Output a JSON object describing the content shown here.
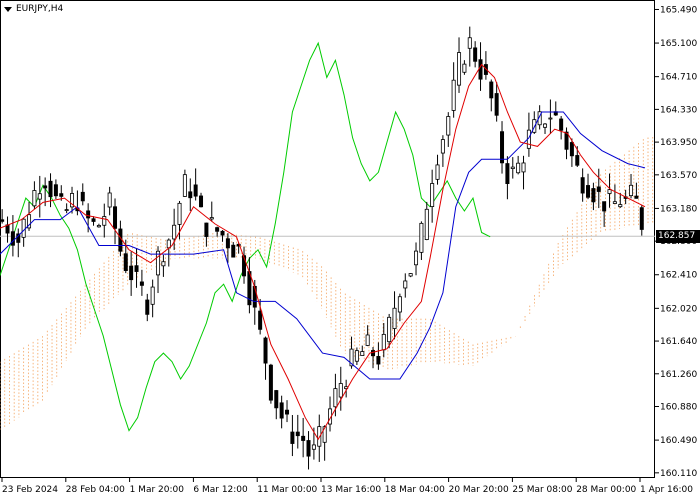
{
  "header": {
    "symbol": "EURJPY,H4",
    "menu_icon": "triangle-down-icon"
  },
  "colors": {
    "background": "#ffffff",
    "candle": "#000000",
    "tenkan": "#e00000",
    "kijun": "#0000d0",
    "chikou": "#00cc00",
    "senkou_a": "#f4a460",
    "senkou_b": "#c9a0b4",
    "current_price_line": "#c0c0c0",
    "price_tag_bg": "#000000"
  },
  "chart_data": {
    "type": "candlestick",
    "symbol": "EURJPY",
    "timeframe": "H4",
    "current_price": "162.857",
    "y_ticks": [
      "165.490",
      "165.100",
      "164.710",
      "164.330",
      "163.950",
      "163.570",
      "163.180",
      "162.800",
      "162.410",
      "162.020",
      "161.640",
      "161.260",
      "160.880",
      "160.490",
      "160.110"
    ],
    "ylim": [
      160.05,
      165.6
    ],
    "x_ticks": [
      "23 Feb 2024",
      "28 Feb 04:00",
      "1 Mar 20:00",
      "6 Mar 12:00",
      "11 Mar 00:00",
      "13 Mar 16:00",
      "18 Mar 04:00",
      "20 Mar 20:00",
      "25 Mar 08:00",
      "28 Mar 00:00",
      "1 Apr 16:00"
    ],
    "close_path": [
      [
        0,
        163.05
      ],
      [
        3,
        163.0
      ],
      [
        6,
        162.9
      ],
      [
        9,
        162.8
      ],
      [
        12,
        163.1
      ],
      [
        15,
        163.3
      ],
      [
        18,
        163.5
      ],
      [
        21,
        163.55
      ],
      [
        24,
        163.4
      ],
      [
        27,
        163.2
      ],
      [
        30,
        163.1
      ],
      [
        33,
        163.25
      ],
      [
        36,
        163.3
      ],
      [
        39,
        163.1
      ],
      [
        42,
        163.0
      ],
      [
        45,
        162.95
      ],
      [
        48,
        163.1
      ],
      [
        51,
        163.2
      ],
      [
        54,
        162.9
      ],
      [
        57,
        162.6
      ],
      [
        60,
        162.5
      ],
      [
        63,
        162.3
      ],
      [
        66,
        162.2
      ],
      [
        69,
        162.1
      ],
      [
        72,
        162.5
      ],
      [
        75,
        162.7
      ],
      [
        78,
        162.8
      ],
      [
        81,
        163.0
      ],
      [
        84,
        163.3
      ],
      [
        87,
        163.5
      ],
      [
        90,
        163.35
      ],
      [
        93,
        163.1
      ],
      [
        96,
        163.0
      ],
      [
        99,
        162.95
      ],
      [
        102,
        162.9
      ],
      [
        105,
        162.85
      ],
      [
        108,
        162.75
      ],
      [
        111,
        162.7
      ],
      [
        114,
        162.5
      ],
      [
        117,
        162.1
      ],
      [
        120,
        161.8
      ],
      [
        123,
        161.5
      ],
      [
        126,
        161.1
      ],
      [
        129,
        160.9
      ],
      [
        132,
        160.7
      ],
      [
        135,
        160.6
      ],
      [
        138,
        160.55
      ],
      [
        141,
        160.5
      ],
      [
        144,
        160.3
      ],
      [
        147,
        160.35
      ],
      [
        150,
        160.6
      ],
      [
        153,
        160.8
      ],
      [
        156,
        161.0
      ],
      [
        159,
        161.2
      ],
      [
        162,
        161.3
      ],
      [
        165,
        161.45
      ],
      [
        168,
        161.5
      ],
      [
        171,
        161.55
      ],
      [
        174,
        161.5
      ],
      [
        177,
        161.45
      ],
      [
        180,
        161.7
      ],
      [
        183,
        162.0
      ],
      [
        186,
        162.3
      ],
      [
        189,
        162.45
      ],
      [
        192,
        162.5
      ],
      [
        195,
        162.7
      ],
      [
        198,
        163.2
      ],
      [
        201,
        163.6
      ],
      [
        204,
        163.9
      ],
      [
        207,
        164.1
      ],
      [
        210,
        164.4
      ],
      [
        213,
        164.8
      ],
      [
        216,
        165.0
      ],
      [
        219,
        165.1
      ],
      [
        222,
        164.9
      ],
      [
        225,
        164.7
      ],
      [
        228,
        164.5
      ],
      [
        231,
        164.1
      ],
      [
        234,
        163.7
      ],
      [
        237,
        163.55
      ],
      [
        240,
        163.6
      ],
      [
        243,
        163.8
      ],
      [
        246,
        164.0
      ],
      [
        249,
        164.1
      ],
      [
        252,
        164.2
      ],
      [
        255,
        164.3
      ],
      [
        258,
        164.25
      ],
      [
        261,
        164.1
      ],
      [
        264,
        163.9
      ],
      [
        267,
        163.7
      ],
      [
        270,
        163.55
      ],
      [
        273,
        163.5
      ],
      [
        276,
        163.4
      ],
      [
        279,
        163.3
      ],
      [
        282,
        163.25
      ],
      [
        285,
        163.2
      ],
      [
        288,
        163.3
      ],
      [
        291,
        163.25
      ],
      [
        294,
        163.3
      ],
      [
        297,
        163.2
      ],
      [
        300,
        162.85
      ]
    ],
    "tenkan": [
      [
        0,
        162.95
      ],
      [
        10,
        163.05
      ],
      [
        20,
        163.25
      ],
      [
        30,
        163.3
      ],
      [
        40,
        163.1
      ],
      [
        50,
        163.05
      ],
      [
        60,
        162.7
      ],
      [
        70,
        162.55
      ],
      [
        80,
        162.75
      ],
      [
        90,
        163.2
      ],
      [
        100,
        163.0
      ],
      [
        110,
        162.85
      ],
      [
        118,
        162.3
      ],
      [
        126,
        161.6
      ],
      [
        134,
        161.2
      ],
      [
        142,
        160.75
      ],
      [
        148,
        160.5
      ],
      [
        156,
        160.85
      ],
      [
        164,
        161.2
      ],
      [
        172,
        161.5
      ],
      [
        180,
        161.55
      ],
      [
        188,
        161.85
      ],
      [
        196,
        162.1
      ],
      [
        200,
        162.6
      ],
      [
        206,
        163.4
      ],
      [
        212,
        164.1
      ],
      [
        218,
        164.6
      ],
      [
        224,
        164.85
      ],
      [
        230,
        164.7
      ],
      [
        236,
        164.3
      ],
      [
        242,
        163.95
      ],
      [
        250,
        163.9
      ],
      [
        258,
        164.1
      ],
      [
        264,
        164.05
      ],
      [
        270,
        163.8
      ],
      [
        276,
        163.6
      ],
      [
        284,
        163.4
      ],
      [
        292,
        163.3
      ],
      [
        300,
        163.2
      ]
    ],
    "kijun": [
      [
        0,
        162.65
      ],
      [
        16,
        163.05
      ],
      [
        28,
        163.05
      ],
      [
        36,
        163.2
      ],
      [
        46,
        162.75
      ],
      [
        60,
        162.75
      ],
      [
        70,
        162.65
      ],
      [
        90,
        162.65
      ],
      [
        104,
        162.7
      ],
      [
        110,
        162.2
      ],
      [
        118,
        162.1
      ],
      [
        128,
        162.1
      ],
      [
        138,
        161.9
      ],
      [
        150,
        161.5
      ],
      [
        160,
        161.45
      ],
      [
        172,
        161.2
      ],
      [
        186,
        161.2
      ],
      [
        194,
        161.5
      ],
      [
        200,
        161.8
      ],
      [
        206,
        162.2
      ],
      [
        212,
        163.2
      ],
      [
        218,
        163.6
      ],
      [
        224,
        163.75
      ],
      [
        236,
        163.75
      ],
      [
        246,
        164.0
      ],
      [
        252,
        164.3
      ],
      [
        262,
        164.3
      ],
      [
        270,
        164.05
      ],
      [
        280,
        163.85
      ],
      [
        292,
        163.7
      ],
      [
        300,
        163.65
      ]
    ],
    "chikou": [
      [
        0,
        162.4
      ],
      [
        4,
        162.7
      ],
      [
        8,
        163.0
      ],
      [
        12,
        163.3
      ],
      [
        16,
        163.2
      ],
      [
        20,
        163.45
      ],
      [
        24,
        163.3
      ],
      [
        28,
        163.1
      ],
      [
        32,
        162.95
      ],
      [
        36,
        162.7
      ],
      [
        40,
        162.3
      ],
      [
        44,
        162.0
      ],
      [
        48,
        161.7
      ],
      [
        52,
        161.3
      ],
      [
        56,
        160.9
      ],
      [
        60,
        160.6
      ],
      [
        64,
        160.75
      ],
      [
        68,
        161.1
      ],
      [
        72,
        161.4
      ],
      [
        76,
        161.5
      ],
      [
        80,
        161.4
      ],
      [
        84,
        161.2
      ],
      [
        88,
        161.35
      ],
      [
        92,
        161.6
      ],
      [
        96,
        161.85
      ],
      [
        100,
        162.2
      ],
      [
        104,
        162.3
      ],
      [
        108,
        162.1
      ],
      [
        112,
        162.4
      ],
      [
        116,
        162.6
      ],
      [
        120,
        162.7
      ],
      [
        124,
        162.5
      ],
      [
        128,
        163.0
      ],
      [
        132,
        163.6
      ],
      [
        136,
        164.3
      ],
      [
        140,
        164.6
      ],
      [
        144,
        164.9
      ],
      [
        148,
        165.1
      ],
      [
        152,
        164.7
      ],
      [
        156,
        164.9
      ],
      [
        160,
        164.5
      ],
      [
        164,
        164.0
      ],
      [
        168,
        163.7
      ],
      [
        172,
        163.5
      ],
      [
        176,
        163.6
      ],
      [
        180,
        163.95
      ],
      [
        184,
        164.3
      ],
      [
        188,
        164.1
      ],
      [
        192,
        163.8
      ],
      [
        196,
        163.3
      ],
      [
        200,
        163.2
      ],
      [
        204,
        163.35
      ],
      [
        208,
        163.5
      ],
      [
        212,
        163.3
      ],
      [
        216,
        163.15
      ],
      [
        220,
        163.3
      ],
      [
        224,
        162.9
      ],
      [
        228,
        162.85
      ]
    ],
    "cloud_span_a": [
      [
        0,
        161.4
      ],
      [
        20,
        161.7
      ],
      [
        40,
        162.3
      ],
      [
        60,
        162.9
      ],
      [
        80,
        162.8
      ],
      [
        100,
        162.9
      ],
      [
        120,
        162.85
      ],
      [
        140,
        162.7
      ],
      [
        150,
        162.5
      ],
      [
        160,
        162.2
      ],
      [
        180,
        161.9
      ],
      [
        200,
        161.9
      ],
      [
        220,
        161.6
      ],
      [
        240,
        161.7
      ],
      [
        260,
        162.8
      ],
      [
        280,
        163.6
      ],
      [
        300,
        164.0
      ],
      [
        320,
        164.05
      ]
    ],
    "cloud_span_b": [
      [
        0,
        160.6
      ],
      [
        20,
        160.95
      ],
      [
        40,
        161.8
      ],
      [
        60,
        162.3
      ],
      [
        80,
        162.6
      ],
      [
        100,
        162.6
      ],
      [
        120,
        162.6
      ],
      [
        140,
        162.4
      ],
      [
        150,
        162.0
      ],
      [
        160,
        161.5
      ],
      [
        180,
        161.3
      ],
      [
        200,
        161.4
      ],
      [
        220,
        161.35
      ],
      [
        240,
        161.7
      ],
      [
        260,
        162.5
      ],
      [
        280,
        162.9
      ],
      [
        300,
        163.0
      ],
      [
        320,
        163.05
      ]
    ]
  }
}
